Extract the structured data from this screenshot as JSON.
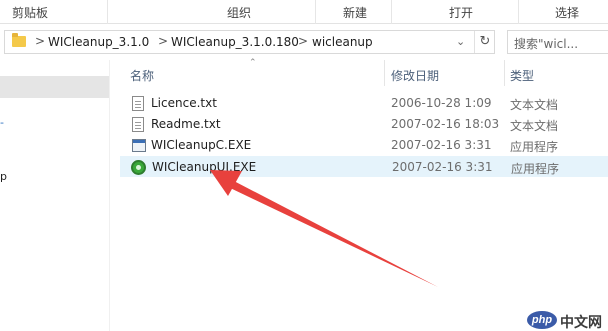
{
  "ribbon": {
    "groups": [
      "剪贴板",
      "组织",
      "新建",
      "打开",
      "选择"
    ]
  },
  "address_bar": {
    "breadcrumbs": [
      "WICleanup_3.1.0",
      "WICleanup_3.1.0.180",
      "wicleanup"
    ],
    "separator": ">",
    "dropdown_icon": "chevron-down-icon",
    "refresh_icon": "refresh-icon"
  },
  "search": {
    "placeholder": "搜索\"wicl..."
  },
  "nav": {
    "fragments": [
      "-",
      "p"
    ]
  },
  "columns": {
    "name": "名称",
    "modified": "修改日期",
    "type": "类型"
  },
  "files": [
    {
      "name": "Licence.txt",
      "modified": "2006-10-28 1:09",
      "type": "文本文档",
      "icon": "text-file-icon"
    },
    {
      "name": "Readme.txt",
      "modified": "2007-02-16 18:03",
      "type": "文本文档",
      "icon": "text-file-icon"
    },
    {
      "name": "WICleanupC.EXE",
      "modified": "2007-02-16 3:31",
      "type": "应用程序",
      "icon": "application-icon"
    },
    {
      "name": "WICleanupUI.EXE",
      "modified": "2007-02-16 3:31",
      "type": "应用程序",
      "icon": "wicleanup-app-icon",
      "highlighted": true
    }
  ],
  "annotation": {
    "arrow_color": "#e8413d"
  },
  "watermark": {
    "logo": "php",
    "text": "中文网"
  },
  "colors": {
    "hover_row": "#e5f3fb",
    "header_text": "#4c607a",
    "nav_selected": "#e5e5e5"
  }
}
